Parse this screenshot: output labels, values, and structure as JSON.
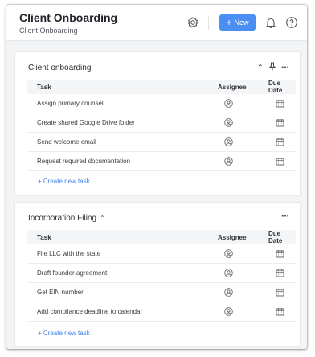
{
  "header": {
    "title": "Client Onboarding",
    "subtitle": "Client Onboarding",
    "new_button_label": "New",
    "icons": [
      "gear-icon",
      "plus-icon",
      "bell-icon",
      "help-icon"
    ]
  },
  "colors": {
    "accent": "#4b8ff2",
    "link": "#3f82e8",
    "background": "#f3f4f6"
  },
  "columns": {
    "task": "Task",
    "assignee": "Assignee",
    "due_date": "Due Date"
  },
  "sections": [
    {
      "title": "Client onboarding",
      "tasks": [
        "Assign primary counsel",
        "Create shared Google Drive folder",
        "Send welcome email",
        "Request required documentation"
      ],
      "create_label": "+ Create new task"
    },
    {
      "title": "Incorporation Filing",
      "tasks": [
        "File LLC with the state",
        "Draft founder agreement",
        "Get EIN number",
        "Add compliance deadline to calendar"
      ],
      "create_label": "+ Create new task"
    }
  ]
}
